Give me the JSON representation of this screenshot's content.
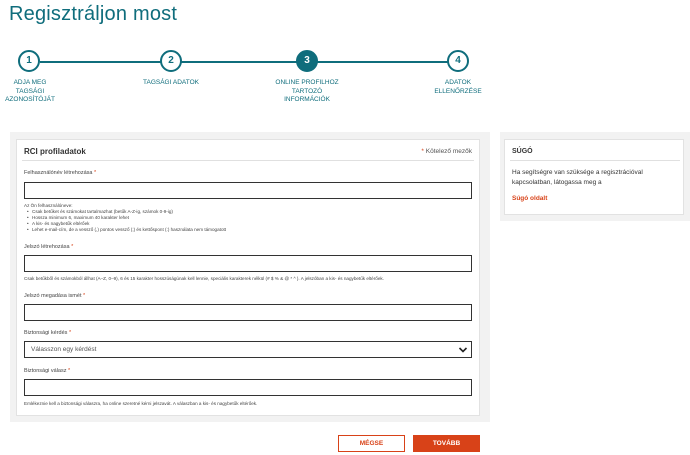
{
  "page": {
    "title": "Regisztráljon most"
  },
  "stepper": {
    "steps": [
      {
        "number": "1",
        "label": "ADJA MEG TAGSÁGI AZONOSÍTÓJÁT",
        "active": false
      },
      {
        "number": "2",
        "label": "TAGSÁGI ADATOK",
        "active": false
      },
      {
        "number": "3",
        "label": "ONLINE PROFILHOZ TARTOZÓ INFORMÁCIÓK",
        "active": true
      },
      {
        "number": "4",
        "label": "ADATOK ELLENŐRZÉSE",
        "active": false
      }
    ]
  },
  "form": {
    "section_title": "RCI profiladatok",
    "required_star": "*",
    "required_note": "Kötelező mezők",
    "username": {
      "label": "Felhasználónév létrehozása",
      "star": "*",
      "value": "",
      "hint_intro": "Az Ön felhasználóneve:",
      "hint_items": [
        "Csak betűket és számokat tartalmazhat (betűk A-Z-ig, számok 0-9-ig)",
        "Hossza minimum 6, maximum 40 karakter lehet",
        "A kis- és nagybetűk eltérőek",
        "Lehet e-mail-cím, de a vessző (,) pontos vessző (;) és kettőspont (:) használata nem támogatott"
      ]
    },
    "password": {
      "label": "Jelszó létrehozása",
      "star": "*",
      "value": "",
      "hint": "Csak betűkből és számokból állhat (A–Z, 0–9), 6 és 15 karakter hosszúságúnak kell lennie, speciális karakterek nélkül (# $ % & @ * ^ ). A jelszóban a kis- és nagybetűk eltérőek."
    },
    "password_confirm": {
      "label": "Jelszó megadása ismét",
      "star": "*",
      "value": ""
    },
    "security_question": {
      "label": "Biztonsági kérdés",
      "star": "*",
      "selected": "Válasszon egy kérdést"
    },
    "security_answer": {
      "label": "Biztonsági válasz",
      "star": "*",
      "value": "",
      "hint": "Emlékeznie kell a biztonsági válaszra, ha online szeretné kérni jelszavát. A válaszban a kis- és nagybetűk eltérőek."
    }
  },
  "help": {
    "title": "SÚGÓ",
    "text": "Ha segítségre van szüksége a regisztrációval kapcsolatban, látogassa meg a",
    "link": "Súgó oldalt"
  },
  "buttons": {
    "cancel": "MÉGSE",
    "next": "TOVÁBB"
  },
  "colors": {
    "brand": "#0f6d7c",
    "accent": "#d84218"
  }
}
